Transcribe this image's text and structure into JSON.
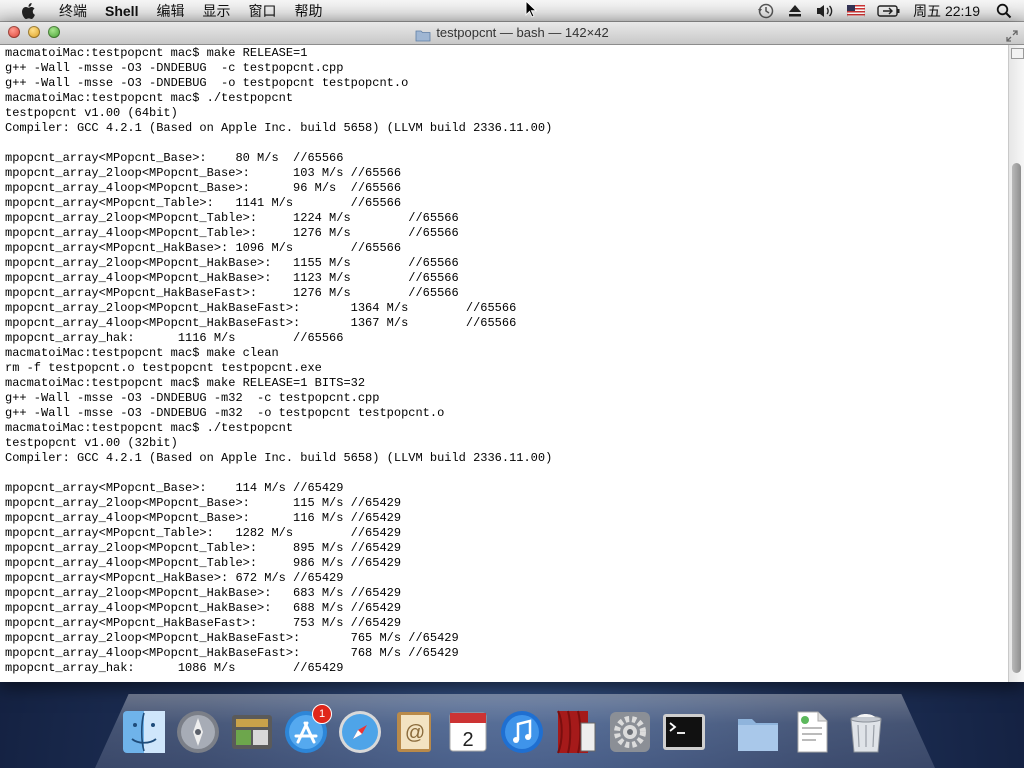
{
  "menubar": {
    "apple_icon": "apple-icon",
    "items": [
      "终端",
      "Shell",
      "编辑",
      "显示",
      "窗口",
      "帮助"
    ],
    "status_icons": [
      "time-machine-icon",
      "eject-icon",
      "volume-icon",
      "us-flag-icon",
      "battery-icon"
    ],
    "clock": "周五 22:19",
    "spotlight_icon": "search-icon"
  },
  "window": {
    "title": "testpopcnt — bash — 142×42",
    "terminal_lines": [
      "macmatoiMac:testpopcnt mac$ make RELEASE=1",
      "g++ -Wall -msse -O3 -DNDEBUG  -c testpopcnt.cpp",
      "g++ -Wall -msse -O3 -DNDEBUG  -o testpopcnt testpopcnt.o",
      "macmatoiMac:testpopcnt mac$ ./testpopcnt",
      "testpopcnt v1.00 (64bit)",
      "Compiler: GCC 4.2.1 (Based on Apple Inc. build 5658) (LLVM build 2336.11.00)",
      "",
      "mpopcnt_array<MPopcnt_Base>:    80 M/s  //65566",
      "mpopcnt_array_2loop<MPopcnt_Base>:      103 M/s //65566",
      "mpopcnt_array_4loop<MPopcnt_Base>:      96 M/s  //65566",
      "mpopcnt_array<MPopcnt_Table>:   1141 M/s        //65566",
      "mpopcnt_array_2loop<MPopcnt_Table>:     1224 M/s        //65566",
      "mpopcnt_array_4loop<MPopcnt_Table>:     1276 M/s        //65566",
      "mpopcnt_array<MPopcnt_HakBase>: 1096 M/s        //65566",
      "mpopcnt_array_2loop<MPopcnt_HakBase>:   1155 M/s        //65566",
      "mpopcnt_array_4loop<MPopcnt_HakBase>:   1123 M/s        //65566",
      "mpopcnt_array<MPopcnt_HakBaseFast>:     1276 M/s        //65566",
      "mpopcnt_array_2loop<MPopcnt_HakBaseFast>:       1364 M/s        //65566",
      "mpopcnt_array_4loop<MPopcnt_HakBaseFast>:       1367 M/s        //65566",
      "mpopcnt_array_hak:      1116 M/s        //65566",
      "macmatoiMac:testpopcnt mac$ make clean",
      "rm -f testpopcnt.o testpopcnt testpopcnt.exe",
      "macmatoiMac:testpopcnt mac$ make RELEASE=1 BITS=32",
      "g++ -Wall -msse -O3 -DNDEBUG -m32  -c testpopcnt.cpp",
      "g++ -Wall -msse -O3 -DNDEBUG -m32  -o testpopcnt testpopcnt.o",
      "macmatoiMac:testpopcnt mac$ ./testpopcnt",
      "testpopcnt v1.00 (32bit)",
      "Compiler: GCC 4.2.1 (Based on Apple Inc. build 5658) (LLVM build 2336.11.00)",
      "",
      "mpopcnt_array<MPopcnt_Base>:    114 M/s //65429",
      "mpopcnt_array_2loop<MPopcnt_Base>:      115 M/s //65429",
      "mpopcnt_array_4loop<MPopcnt_Base>:      116 M/s //65429",
      "mpopcnt_array<MPopcnt_Table>:   1282 M/s        //65429",
      "mpopcnt_array_2loop<MPopcnt_Table>:     895 M/s //65429",
      "mpopcnt_array_4loop<MPopcnt_Table>:     986 M/s //65429",
      "mpopcnt_array<MPopcnt_HakBase>: 672 M/s //65429",
      "mpopcnt_array_2loop<MPopcnt_HakBase>:   683 M/s //65429",
      "mpopcnt_array_4loop<MPopcnt_HakBase>:   688 M/s //65429",
      "mpopcnt_array<MPopcnt_HakBaseFast>:     753 M/s //65429",
      "mpopcnt_array_2loop<MPopcnt_HakBaseFast>:       765 M/s //65429",
      "mpopcnt_array_4loop<MPopcnt_HakBaseFast>:       768 M/s //65429",
      "mpopcnt_array_hak:      1086 M/s        //65429"
    ]
  },
  "dock": {
    "items": [
      {
        "name": "finder-icon"
      },
      {
        "name": "launchpad-icon"
      },
      {
        "name": "image-capture-icon"
      },
      {
        "name": "app-store-icon",
        "badge": "1"
      },
      {
        "name": "safari-icon"
      },
      {
        "name": "address-book-icon"
      },
      {
        "name": "calendar-icon",
        "day": "2"
      },
      {
        "name": "itunes-icon"
      },
      {
        "name": "photo-booth-icon"
      },
      {
        "name": "system-preferences-icon"
      },
      {
        "name": "terminal-icon"
      },
      {
        "name": "applications-folder-icon"
      },
      {
        "name": "document-icon"
      },
      {
        "name": "trash-icon"
      }
    ]
  }
}
